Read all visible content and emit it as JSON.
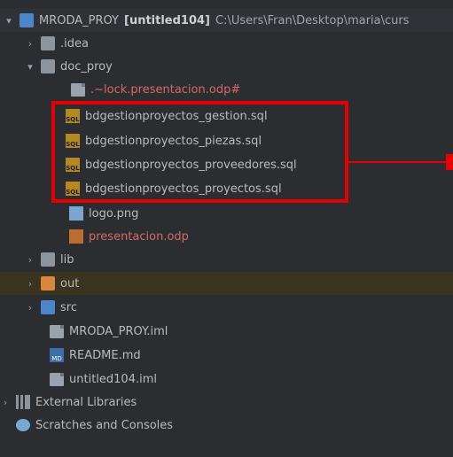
{
  "project": {
    "name": "MRODA_PROY",
    "module": "[untitled104]",
    "path": "C:\\Users\\Fran\\Desktop\\maria\\curs"
  },
  "tree": {
    "idea": ".idea",
    "doc_proy": "doc_proy",
    "lock_file": ".~lock.presentacion.odp#",
    "sql_files": [
      "bdgestionproyectos_gestion.sql",
      "bdgestionproyectos_piezas.sql",
      "bdgestionproyectos_proveedores.sql",
      "bdgestionproyectos_proyectos.sql"
    ],
    "logo": "logo.png",
    "presentacion": "presentacion.odp",
    "lib": "lib",
    "out": "out",
    "src": "src",
    "iml_main": "MRODA_PROY.iml",
    "readme": "README.md",
    "iml_untitled": "untitled104.iml",
    "external_libraries": "External Libraries",
    "scratches": "Scratches and Consoles"
  },
  "colors": {
    "highlight": "#e60000",
    "red_text": "#d46a6a"
  },
  "icons": {
    "sql_badge": "SQL",
    "md_badge": "MD"
  }
}
